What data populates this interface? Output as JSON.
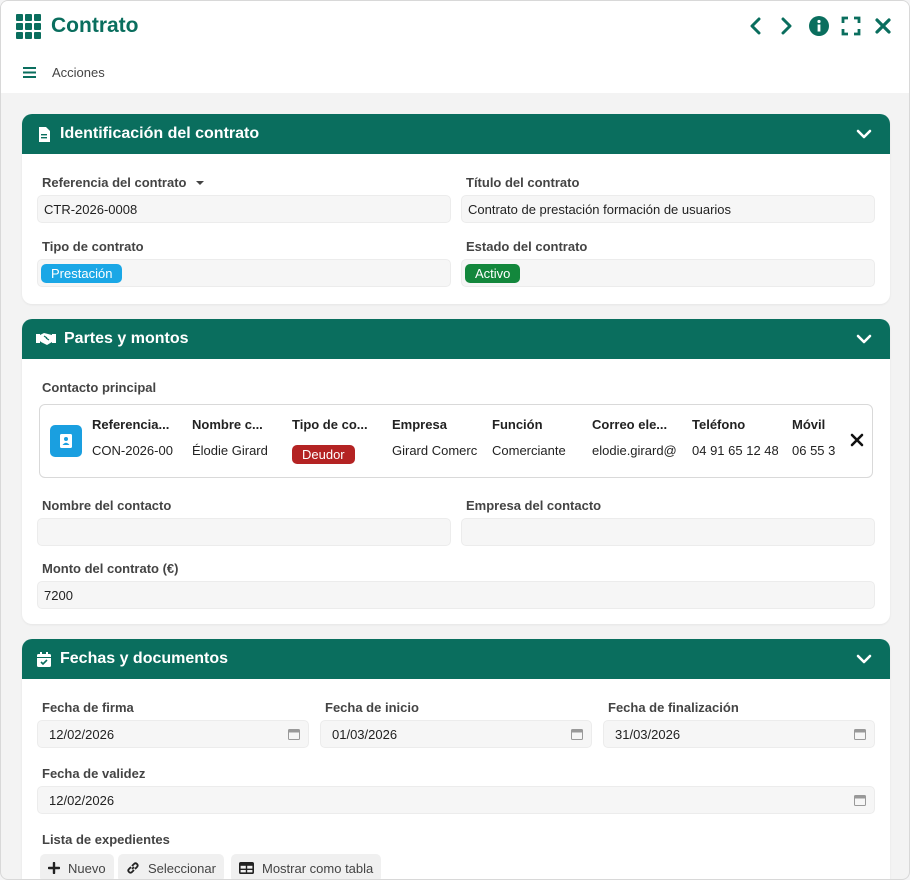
{
  "app": {
    "title": "Contrato"
  },
  "actions": {
    "label": "Acciones"
  },
  "sections": {
    "identification": {
      "title": "Identificación del contrato",
      "fields": {
        "reference": {
          "label": "Referencia del contrato",
          "value": "CTR-2026-0008"
        },
        "title": {
          "label": "Título del contrato",
          "value": "Contrato de prestación formación de usuarios"
        },
        "type": {
          "label": "Tipo de contrato",
          "value": "Prestación"
        },
        "status": {
          "label": "Estado del contrato",
          "value": "Activo"
        }
      }
    },
    "parties": {
      "title": "Partes y montos",
      "primary_contact": {
        "label": "Contacto principal",
        "columns": [
          "Referencia...",
          "Nombre c...",
          "Tipo de co...",
          "Empresa",
          "Función",
          "Correo ele...",
          "Teléfono",
          "Móvil"
        ],
        "values": [
          "CON-2026-00",
          "Élodie Girard",
          "Deudor",
          "Girard Comerc",
          "Comerciante",
          "elodie.girard@",
          "04 91 65 12 48",
          "06 55 3"
        ]
      },
      "contact_name": {
        "label": "Nombre del contacto",
        "value": ""
      },
      "contact_company": {
        "label": "Empresa del contacto",
        "value": ""
      },
      "amount": {
        "label": "Monto del contrato (€)",
        "value": "7200"
      }
    },
    "dates": {
      "title": "Fechas y documentos",
      "signature": {
        "label": "Fecha de firma",
        "value": "12/02/2026"
      },
      "start": {
        "label": "Fecha de inicio",
        "value": "01/03/2026"
      },
      "end": {
        "label": "Fecha de finalización",
        "value": "31/03/2026"
      },
      "validity": {
        "label": "Fecha de validez",
        "value": "12/02/2026"
      },
      "files": {
        "label": "Lista de expedientes",
        "new_label": "Nuevo",
        "select_label": "Seleccionar",
        "table_label": "Mostrar como tabla"
      }
    }
  },
  "colors": {
    "primary": "#0a6e5e",
    "badge_type": "#1aa7e6",
    "badge_active": "#13873c",
    "badge_debtor": "#b42323"
  }
}
